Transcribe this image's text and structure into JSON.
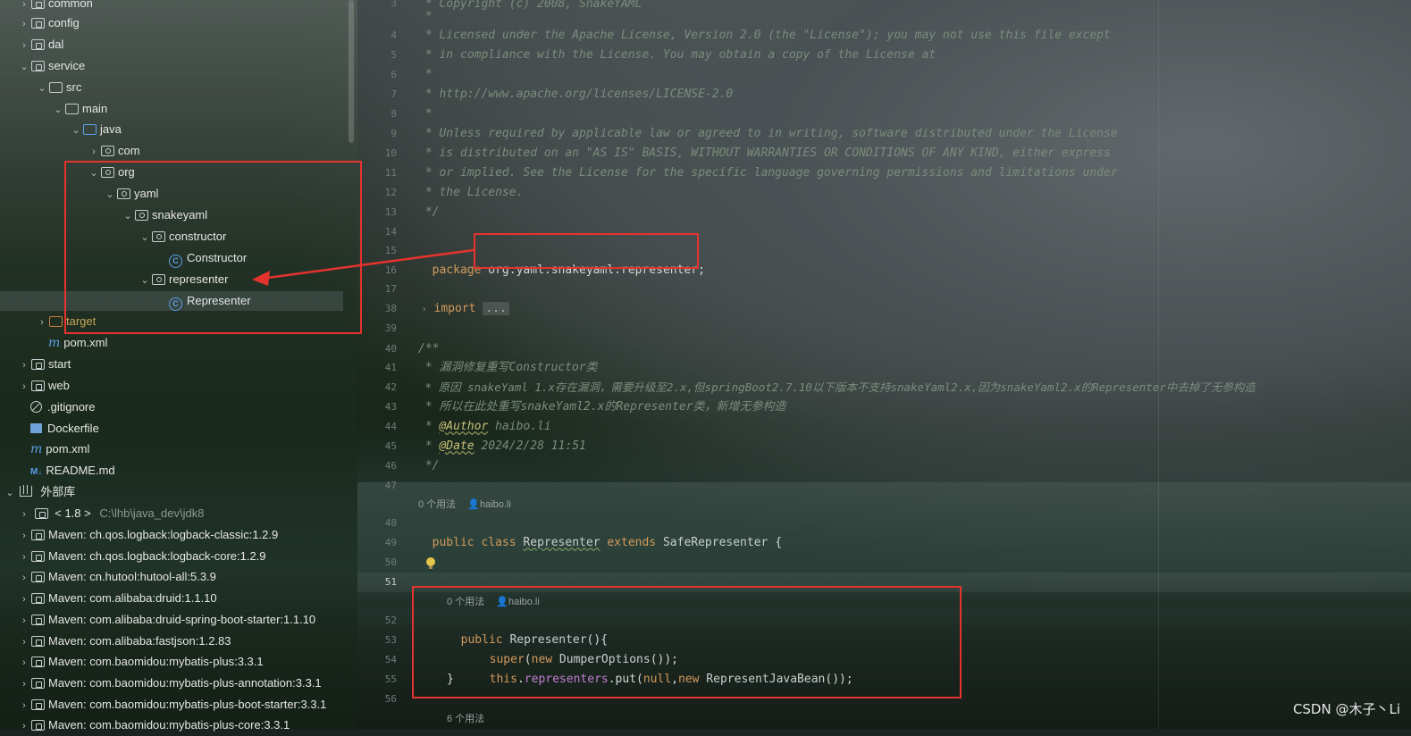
{
  "tree": {
    "items": [
      {
        "label": "common",
        "arrow": "›",
        "type": "module"
      },
      {
        "label": "config",
        "arrow": "›",
        "type": "module"
      },
      {
        "label": "dal",
        "arrow": "›",
        "type": "module"
      },
      {
        "label": "service",
        "arrow": "⌄",
        "type": "module"
      },
      {
        "label": "src",
        "arrow": "⌄",
        "type": "folder"
      },
      {
        "label": "main",
        "arrow": "⌄",
        "type": "folder"
      },
      {
        "label": "java",
        "arrow": "⌄",
        "type": "folder-blue"
      },
      {
        "label": "com",
        "arrow": "›",
        "type": "package"
      },
      {
        "label": "org",
        "arrow": "⌄",
        "type": "package"
      },
      {
        "label": "yaml",
        "arrow": "⌄",
        "type": "package"
      },
      {
        "label": "snakeyaml",
        "arrow": "⌄",
        "type": "package"
      },
      {
        "label": "constructor",
        "arrow": "⌄",
        "type": "package"
      },
      {
        "label": "Constructor",
        "arrow": "",
        "type": "class"
      },
      {
        "label": "representer",
        "arrow": "⌄",
        "type": "package"
      },
      {
        "label": "Representer",
        "arrow": "",
        "type": "class"
      },
      {
        "label": "target",
        "arrow": "›",
        "type": "folder-orange"
      },
      {
        "label": "pom.xml",
        "arrow": "",
        "type": "maven"
      },
      {
        "label": "start",
        "arrow": "›",
        "type": "module"
      },
      {
        "label": "web",
        "arrow": "›",
        "type": "module"
      },
      {
        "label": ".gitignore",
        "arrow": "",
        "type": "ignore"
      },
      {
        "label": "Dockerfile",
        "arrow": "",
        "type": "docker"
      },
      {
        "label": "pom.xml",
        "arrow": "",
        "type": "maven"
      },
      {
        "label": "README.md",
        "arrow": "",
        "type": "md"
      }
    ],
    "external_libs": "外部库",
    "jdk": {
      "label": "< 1.8 >",
      "path": "C:\\lhb\\java_dev\\jdk8"
    },
    "libs": [
      "Maven: ch.qos.logback:logback-classic:1.2.9",
      "Maven: ch.qos.logback:logback-core:1.2.9",
      "Maven: cn.hutool:hutool-all:5.3.9",
      "Maven: com.alibaba:druid:1.1.10",
      "Maven: com.alibaba:druid-spring-boot-starter:1.1.10",
      "Maven: com.alibaba:fastjson:1.2.83",
      "Maven: com.baomidou:mybatis-plus:3.3.1",
      "Maven: com.baomidou:mybatis-plus-annotation:3.3.1",
      "Maven: com.baomidou:mybatis-plus-boot-starter:3.3.1",
      "Maven: com.baomidou:mybatis-plus-core:3.3.1"
    ]
  },
  "editor": {
    "line_numbers": [
      "3",
      "4",
      "5",
      "6",
      "7",
      "8",
      "9",
      "10",
      "11",
      "12",
      "13",
      "14",
      "15",
      "16",
      "17",
      "38",
      "39",
      "40",
      "41",
      "42",
      "43",
      "44",
      "45",
      "46",
      "47",
      "48",
      "49",
      "50",
      "51",
      "52",
      "53",
      "54",
      "55",
      "56"
    ],
    "license": {
      "l3": " * Copyright (c) 2008, SnakeYAML",
      "l3b": " *",
      "l4": " * Licensed under the Apache License, Version 2.0 (the \"License\"); you may not use this file except",
      "l5": " * in compliance with the License. You may obtain a copy of the License at",
      "l6": " *",
      "l7": " * http://www.apache.org/licenses/LICENSE-2.0",
      "l8": " *",
      "l9": " * Unless required by applicable law or agreed to in writing, software distributed under the License",
      "l10": " * is distributed on an \"AS IS\" BASIS, WITHOUT WARRANTIES OR CONDITIONS OF ANY KIND, either express",
      "l11": " * or implied. See the License for the specific language governing permissions and limitations under",
      "l12": " * the License.",
      "l13": " */"
    },
    "package_kw": "package",
    "package_name": "org.yaml.snakeyaml.representer;",
    "import_kw": "import",
    "import_fold": "...",
    "doc": {
      "open": "/**",
      "l41": " * 漏洞修复重写Constructor类",
      "l42": " * 原因 snakeYaml 1.x存在漏洞，需要升级至2.x,但springBoot2.7.10以下版本不支持snakeYaml2.x,因为snakeYaml2.x的Representer中去掉了无参构造",
      "l43": " * 所以在此处重写snakeYaml2.x的Representer类，新增无参构造",
      "author_tag": "@Author",
      "author": " haibo.li",
      "date_tag": "@Date",
      "date": " 2024/2/28 11:51",
      "close": " */"
    },
    "usage_hint": "0 个用法",
    "author_hint": "haibo.li",
    "class_decl": {
      "public": "public",
      "class": "class",
      "name": "Representer",
      "extends": "extends",
      "super": "SafeRepresenter",
      "brace": " {"
    },
    "ctor": {
      "public": "public",
      "name": "Representer",
      "sig": "(){",
      "super": "super",
      "super_args_open": "(",
      "new1": "new",
      "dumper": " DumperOptions",
      "super_args_close": "());",
      "this": "this",
      "dot": ".",
      "field": "representers",
      "put": ".put(",
      "null": "null",
      "comma": ",",
      "new2": "new",
      "rjb": " RepresentJavaBean",
      "tail": "());",
      "close": "}"
    },
    "next_usage_hint": "6 个用法"
  },
  "watermark": "CSDN @木子丶Li",
  "colors": {
    "annotation_red": "#e5332e",
    "accent_blue": "#5aa0e8"
  }
}
